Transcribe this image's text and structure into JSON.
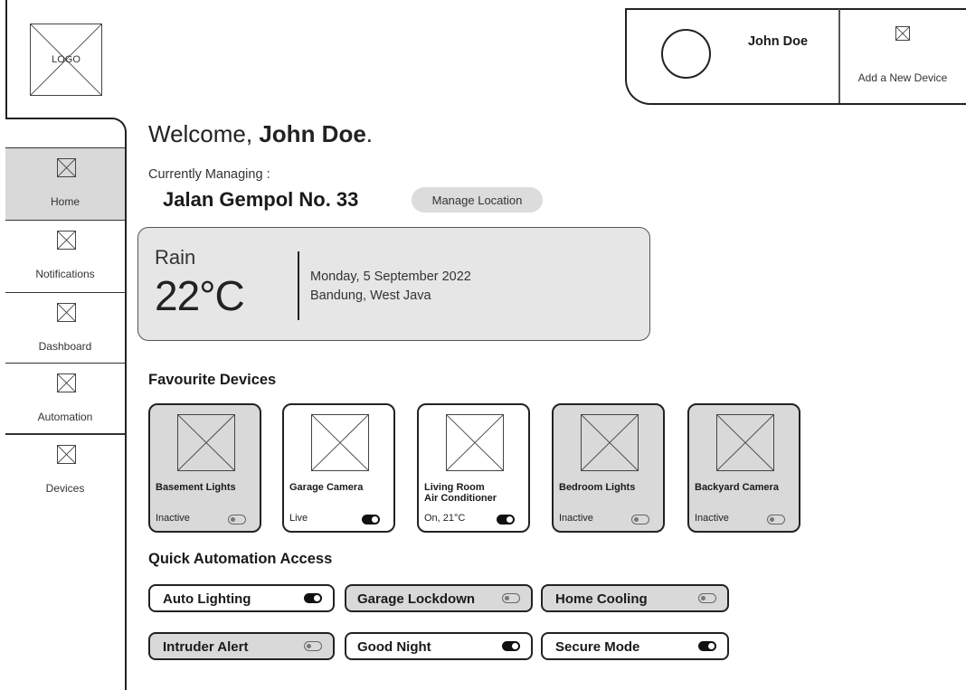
{
  "logo": {
    "label": "LOGO"
  },
  "header": {
    "user_name": "John Doe",
    "add_device_label": "Add a New Device"
  },
  "sidebar": {
    "items": [
      {
        "label": "Home",
        "icon": "home-icon",
        "active": true
      },
      {
        "label": "Notifications",
        "icon": "notifications-icon",
        "active": false
      },
      {
        "label": "Dashboard",
        "icon": "dashboard-icon",
        "active": false
      },
      {
        "label": "Automation",
        "icon": "automation-icon",
        "active": false
      },
      {
        "label": "Devices",
        "icon": "devices-icon",
        "active": false
      }
    ]
  },
  "welcome": {
    "prefix": "Welcome, ",
    "name": "John Doe",
    "suffix": "."
  },
  "location": {
    "managing_label": "Currently Managing :",
    "name": "Jalan Gempol No. 33",
    "manage_button": "Manage Location"
  },
  "weather": {
    "condition": "Rain",
    "temperature": "22°C",
    "date": "Monday, 5 September 2022",
    "place": "Bandung, West Java"
  },
  "favourites": {
    "title": "Favourite Devices",
    "devices": [
      {
        "name": "Basement Lights",
        "status": "Inactive",
        "on": false
      },
      {
        "name": "Garage Camera",
        "status": "Live",
        "on": true
      },
      {
        "name": "Living Room\nAir Conditioner",
        "status": "On, 21°C",
        "on": true
      },
      {
        "name": "Bedroom Lights",
        "status": "Inactive",
        "on": false
      },
      {
        "name": "Backyard Camera",
        "status": "Inactive",
        "on": false
      }
    ]
  },
  "automation": {
    "title": "Quick Automation Access",
    "items": [
      {
        "label": "Auto Lighting",
        "on": true
      },
      {
        "label": "Garage Lockdown",
        "on": false
      },
      {
        "label": "Home Cooling",
        "on": false
      },
      {
        "label": "Intruder Alert",
        "on": false
      },
      {
        "label": "Good Night",
        "on": true
      },
      {
        "label": "Secure Mode",
        "on": true
      }
    ]
  },
  "colors": {
    "active_bg": "#d9d9d9",
    "card_bg": "#e6e6e6",
    "border": "#222222"
  }
}
